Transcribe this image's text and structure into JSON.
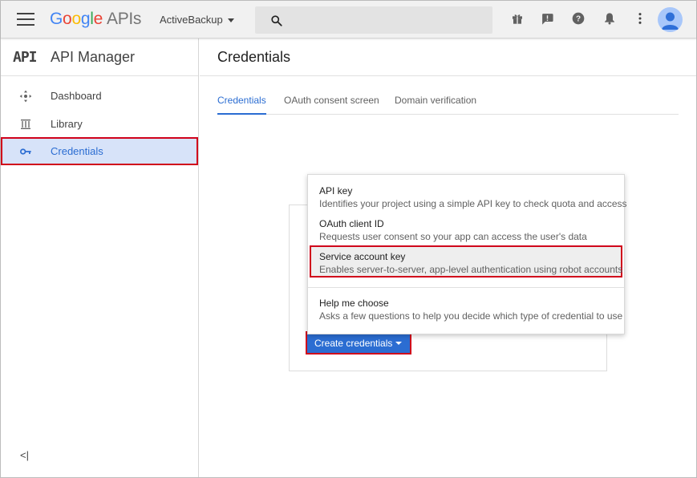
{
  "topbar": {
    "brand_letters": [
      "G",
      "o",
      "o",
      "g",
      "l",
      "e"
    ],
    "brand_suffix": "APIs",
    "project_name": "ActiveBackup",
    "search_placeholder": "",
    "icons": [
      "gift-icon",
      "feedback-icon",
      "help-icon",
      "notifications-icon",
      "more-vert-icon",
      "account-avatar-icon"
    ]
  },
  "sidebar": {
    "logo_text": "API",
    "title": "API Manager",
    "items": [
      {
        "label": "Dashboard",
        "icon": "dashboard-icon",
        "active": false
      },
      {
        "label": "Library",
        "icon": "library-icon",
        "active": false
      },
      {
        "label": "Credentials",
        "icon": "key-icon",
        "active": true
      }
    ],
    "collapse_label": "<|"
  },
  "main": {
    "title": "Credentials",
    "tabs": [
      {
        "label": "Credentials",
        "active": true
      },
      {
        "label": "OAuth consent screen",
        "active": false
      },
      {
        "label": "Domain verification",
        "active": false
      }
    ],
    "create_button": "Create credentials",
    "menu": [
      {
        "title": "API key",
        "description": "Identifies your project using a simple API key to check quota and access"
      },
      {
        "title": "OAuth client ID",
        "description": "Requests user consent so your app can access the user's data"
      },
      {
        "title": "Service account key",
        "description": "Enables server-to-server, app-level authentication using robot accounts",
        "highlighted": true
      },
      {
        "title": "Help me choose",
        "description": "Asks a few questions to help you decide which type of credential to use"
      }
    ]
  },
  "colors": {
    "accent": "#2b6dd2",
    "highlight_border": "#d0021b",
    "active_nav_bg": "#d7e3f9"
  }
}
